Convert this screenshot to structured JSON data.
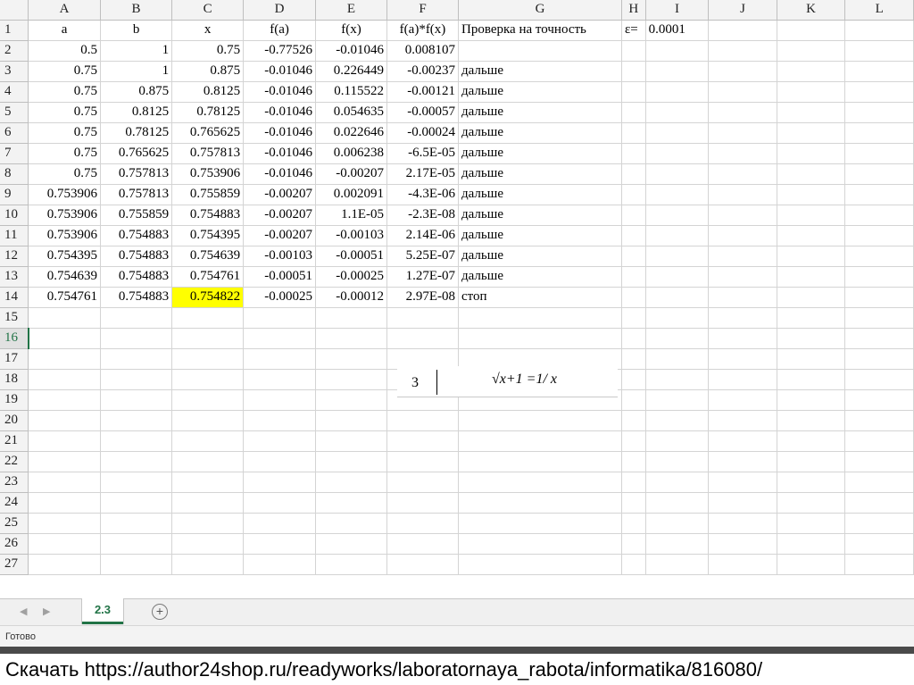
{
  "sheet": {
    "columns": [
      "A",
      "B",
      "C",
      "D",
      "E",
      "F",
      "G",
      "H",
      "I",
      "J",
      "K",
      "L"
    ],
    "rows": [
      [
        "a",
        "b",
        "x",
        "f(a)",
        "f(x)",
        "f(a)*f(x)",
        "Проверка на точность",
        "ε=",
        "0.0001",
        "",
        "",
        ""
      ],
      [
        "0.5",
        "1",
        "0.75",
        "-0.77526",
        "-0.01046",
        "0.008107",
        "",
        "",
        "",
        "",
        "",
        ""
      ],
      [
        "0.75",
        "1",
        "0.875",
        "-0.01046",
        "0.226449",
        "-0.00237",
        "дальше",
        "",
        "",
        "",
        "",
        ""
      ],
      [
        "0.75",
        "0.875",
        "0.8125",
        "-0.01046",
        "0.115522",
        "-0.00121",
        "дальше",
        "",
        "",
        "",
        "",
        ""
      ],
      [
        "0.75",
        "0.8125",
        "0.78125",
        "-0.01046",
        "0.054635",
        "-0.00057",
        "дальше",
        "",
        "",
        "",
        "",
        ""
      ],
      [
        "0.75",
        "0.78125",
        "0.765625",
        "-0.01046",
        "0.022646",
        "-0.00024",
        "дальше",
        "",
        "",
        "",
        "",
        ""
      ],
      [
        "0.75",
        "0.765625",
        "0.757813",
        "-0.01046",
        "0.006238",
        "-6.5E-05",
        "дальше",
        "",
        "",
        "",
        "",
        ""
      ],
      [
        "0.75",
        "0.757813",
        "0.753906",
        "-0.01046",
        "-0.00207",
        "2.17E-05",
        "дальше",
        "",
        "",
        "",
        "",
        ""
      ],
      [
        "0.753906",
        "0.757813",
        "0.755859",
        "-0.00207",
        "0.002091",
        "-4.3E-06",
        "дальше",
        "",
        "",
        "",
        "",
        ""
      ],
      [
        "0.753906",
        "0.755859",
        "0.754883",
        "-0.00207",
        "1.1E-05",
        "-2.3E-08",
        "дальше",
        "",
        "",
        "",
        "",
        ""
      ],
      [
        "0.753906",
        "0.754883",
        "0.754395",
        "-0.00207",
        "-0.00103",
        "2.14E-06",
        "дальше",
        "",
        "",
        "",
        "",
        ""
      ],
      [
        "0.754395",
        "0.754883",
        "0.754639",
        "-0.00103",
        "-0.00051",
        "5.25E-07",
        "дальше",
        "",
        "",
        "",
        "",
        ""
      ],
      [
        "0.754639",
        "0.754883",
        "0.754761",
        "-0.00051",
        "-0.00025",
        "1.27E-07",
        "дальше",
        "",
        "",
        "",
        "",
        ""
      ],
      [
        "0.754761",
        "0.754883",
        "0.754822",
        "-0.00025",
        "-0.00012",
        "2.97E-08",
        "стоп",
        "",
        "",
        "",
        "",
        ""
      ],
      [
        "",
        "",
        "",
        "",
        "",
        "",
        "",
        "",
        "",
        "",
        "",
        ""
      ],
      [
        "",
        "",
        "",
        "",
        "",
        "",
        "",
        "",
        "",
        "",
        "",
        ""
      ],
      [
        "",
        "",
        "",
        "",
        "",
        "",
        "",
        "",
        "",
        "",
        "",
        ""
      ],
      [
        "",
        "",
        "",
        "",
        "",
        "",
        "",
        "",
        "",
        "",
        "",
        ""
      ],
      [
        "",
        "",
        "",
        "",
        "",
        "",
        "",
        "",
        "",
        "",
        "",
        ""
      ],
      [
        "",
        "",
        "",
        "",
        "",
        "",
        "",
        "",
        "",
        "",
        "",
        ""
      ],
      [
        "",
        "",
        "",
        "",
        "",
        "",
        "",
        "",
        "",
        "",
        "",
        ""
      ],
      [
        "",
        "",
        "",
        "",
        "",
        "",
        "",
        "",
        "",
        "",
        "",
        ""
      ],
      [
        "",
        "",
        "",
        "",
        "",
        "",
        "",
        "",
        "",
        "",
        "",
        ""
      ],
      [
        "",
        "",
        "",
        "",
        "",
        "",
        "",
        "",
        "",
        "",
        "",
        ""
      ],
      [
        "",
        "",
        "",
        "",
        "",
        "",
        "",
        "",
        "",
        "",
        "",
        ""
      ],
      [
        "",
        "",
        "",
        "",
        "",
        "",
        "",
        "",
        "",
        "",
        "",
        ""
      ],
      [
        "",
        "",
        "",
        "",
        "",
        "",
        "",
        "",
        "",
        "",
        "",
        ""
      ]
    ],
    "active_row": 16,
    "highlight_cell": {
      "row": 14,
      "col": "C",
      "color": "#ffff00"
    }
  },
  "formula": {
    "number": "3",
    "equation": "√x+1 =1/ x"
  },
  "tabs": {
    "active_sheet": "2.3",
    "add_icon": "plus-circle-icon",
    "nav_prev": "◀",
    "nav_next": "▶"
  },
  "status": {
    "text": "Готово"
  },
  "caption": {
    "text": "Скачать https://author24shop.ru/readyworks/laboratornaya_rabota/informatika/816080/"
  },
  "colors": {
    "accent": "#217346",
    "highlight": "#ffff00",
    "header_bg": "#f3f3f3",
    "grid": "#d4d4d4"
  }
}
